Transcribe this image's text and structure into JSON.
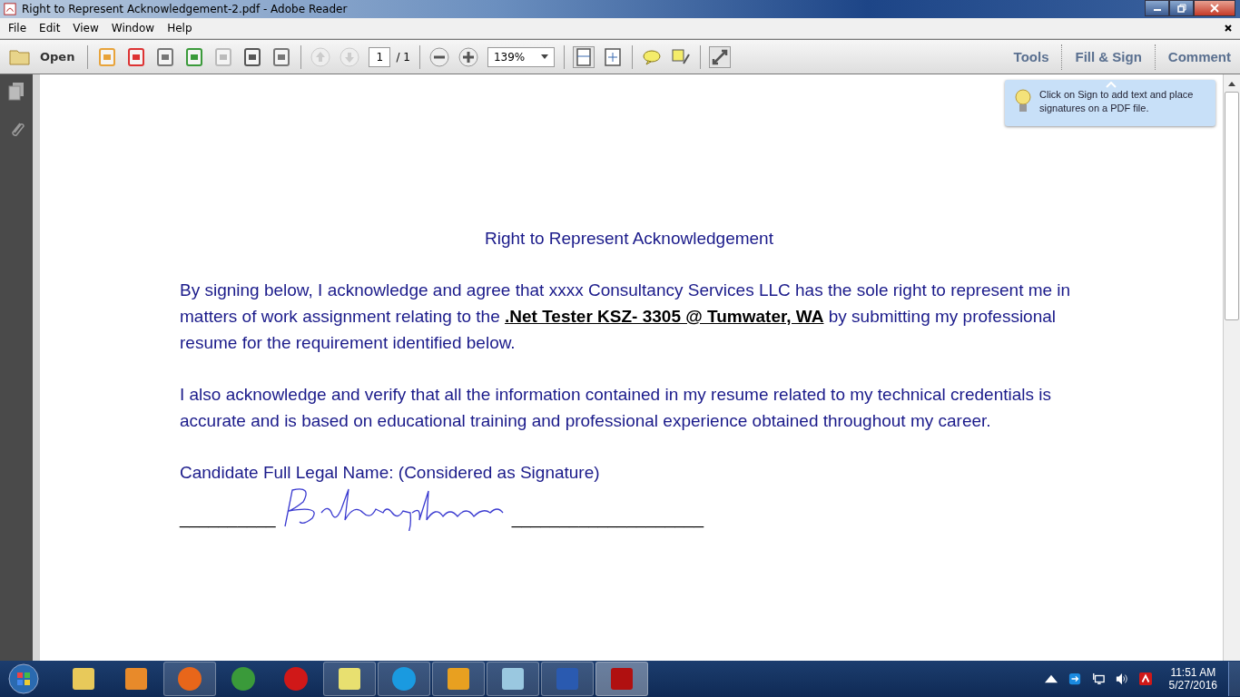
{
  "window": {
    "title": "Right to Represent Acknowledgement-2.pdf - Adobe Reader"
  },
  "menu": [
    "File",
    "Edit",
    "View",
    "Window",
    "Help"
  ],
  "toolbar": {
    "open_label": "Open",
    "page_number": "1",
    "page_total": "/ 1",
    "zoom": "139%",
    "panes": [
      "Tools",
      "Fill & Sign",
      "Comment"
    ]
  },
  "tip": {
    "text": "Click on Sign to add text and place signatures on a PDF file."
  },
  "document": {
    "title": "Right to Represent Acknowledgement",
    "paragraphs": [
      "By signing below, I acknowledge and agree that xxxx Consultancy Services LLC has the sole right to represent me in matters of work assignment relating to the **.Net Tester KSZ- 3305 @ Tumwater, WA** by submitting my professional resume for the requirement identified below.",
      "I also acknowledge and verify that all the information contained in my resume related to my technical credentials is accurate and is based on educational training and professional experience obtained throughout my career."
    ],
    "name_label": "Candidate Full Legal Name: (Considered as Signature)",
    "line_before": "__________",
    "line_after": "____________________"
  },
  "taskbar": {
    "time": "11:51 AM",
    "date": "5/27/2016"
  }
}
